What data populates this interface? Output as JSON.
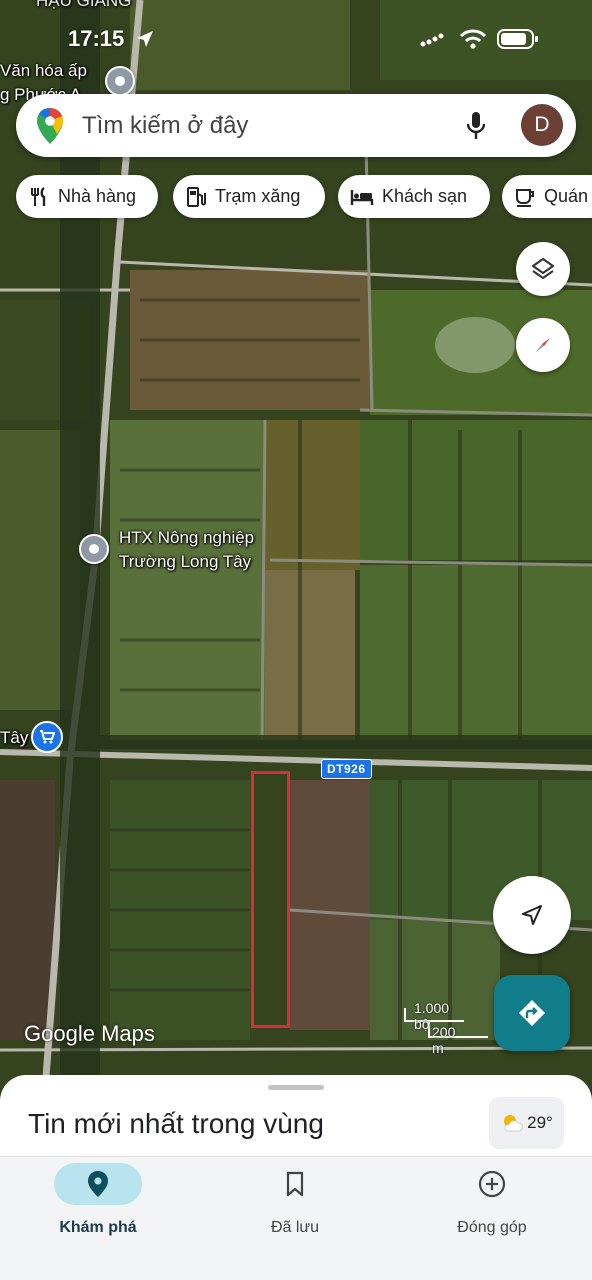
{
  "status_bar": {
    "time": "17:15"
  },
  "map": {
    "labels": {
      "top_cut_label": "HẬU GIANG",
      "cultural_house": "Văn hóa ấp",
      "cultural_house_line2": "g Phước A",
      "cooperative_line1": "HTX Nông nghiệp",
      "cooperative_line2": "Trường Long Tây",
      "left_shop": "Tây"
    },
    "road_sign": "DT926",
    "highlight_color": "#e02a35",
    "watermark_google": "Google",
    "watermark_maps": "Maps",
    "scale": {
      "top": "1.000 bộ",
      "bottom": "200 m"
    }
  },
  "search": {
    "placeholder": "Tìm kiếm ở đây",
    "avatar_letter": "D"
  },
  "chips": [
    {
      "label": "Nhà hàng",
      "icon": "restaurant-icon"
    },
    {
      "label": "Trạm xăng",
      "icon": "gas-station-icon"
    },
    {
      "label": "Khách sạn",
      "icon": "hotel-icon"
    },
    {
      "label": "Quán",
      "icon": "cafe-icon"
    }
  ],
  "sheet": {
    "title": "Tin mới nhất trong vùng",
    "weather": "29°"
  },
  "nav": [
    {
      "label": "Khám phá",
      "icon": "explore-pin-icon",
      "active": true
    },
    {
      "label": "Đã lưu",
      "icon": "bookmark-icon",
      "active": false
    },
    {
      "label": "Đóng góp",
      "icon": "add-circle-icon",
      "active": false
    }
  ],
  "colors": {
    "accent_teal": "#117c8a",
    "nav_active_bg": "#b8e4f0",
    "road_sign_blue": "#1a73e8"
  }
}
